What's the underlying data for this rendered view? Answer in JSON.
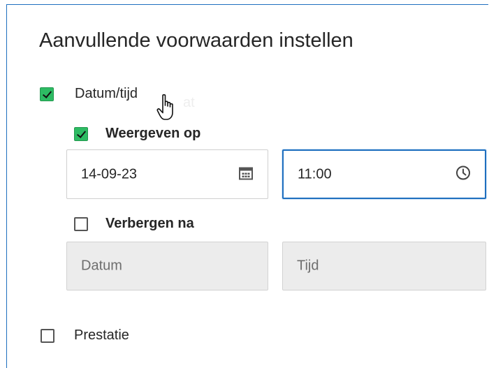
{
  "title": "Aanvullende voorwaarden instellen",
  "date_time": {
    "label": "Datum/tijd",
    "ghost_text": "at",
    "checked": true,
    "show_on": {
      "label": "Weergeven op",
      "checked": true,
      "date_value": "14-09-23",
      "time_value": "11:00"
    },
    "hide_after": {
      "label": "Verbergen na",
      "checked": false,
      "date_placeholder": "Datum",
      "time_placeholder": "Tijd"
    }
  },
  "performance": {
    "label": "Prestatie",
    "checked": false
  },
  "icons": {
    "date": "calendar-icon",
    "time": "clock-icon",
    "cursor": "hand-pointer-icon"
  },
  "colors": {
    "checkbox_checked": "#2dbb63",
    "focus_border": "#1f6fbf",
    "disabled_field": "#ececec"
  }
}
